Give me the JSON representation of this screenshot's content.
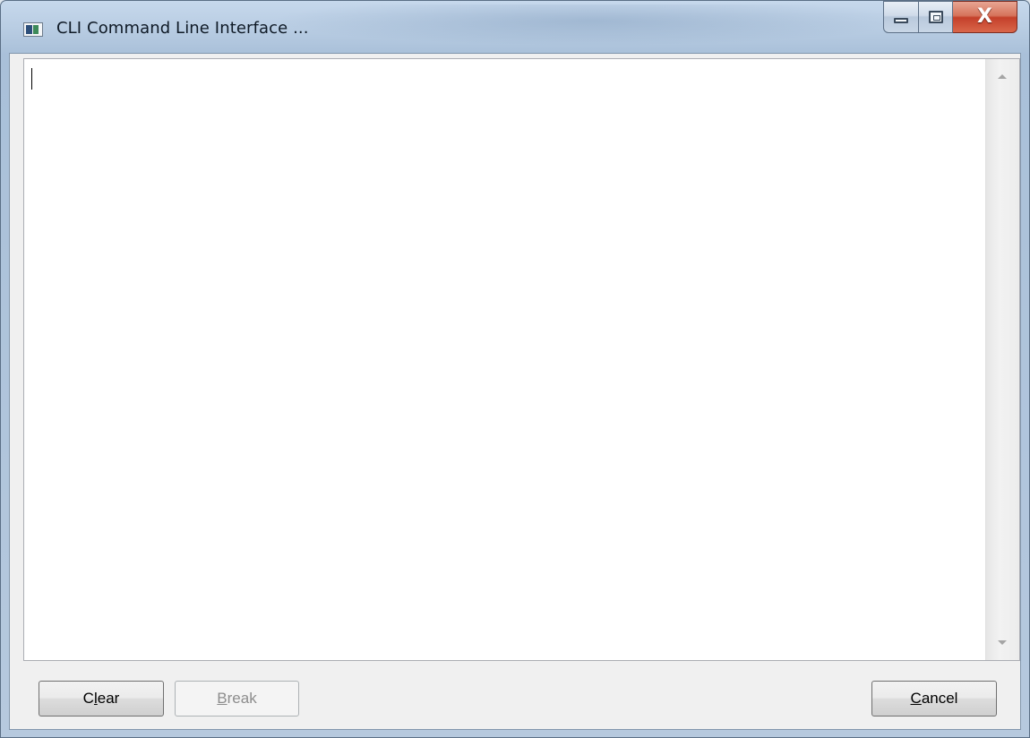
{
  "window": {
    "title": "CLI Command Line Interface ...",
    "icon": "console-app-icon",
    "controls": {
      "minimize_icon": "minimize-icon",
      "maximize_icon": "maximize-icon",
      "close_symbol": "X"
    }
  },
  "console": {
    "text": "",
    "scrollbar": {
      "up_icon": "scroll-up-arrow-icon",
      "down_icon": "scroll-down-arrow-icon"
    }
  },
  "buttons": {
    "clear": {
      "before": "C",
      "mnemonic": "l",
      "after": "ear",
      "enabled": true
    },
    "break": {
      "before": "",
      "mnemonic": "B",
      "after": "reak",
      "enabled": false
    },
    "cancel": {
      "before": "",
      "mnemonic": "C",
      "after": "ancel",
      "enabled": true
    }
  },
  "colors": {
    "close_button": "#c4402a",
    "frame": "#b9cde3",
    "disabled_text": "#8d8d8d"
  }
}
